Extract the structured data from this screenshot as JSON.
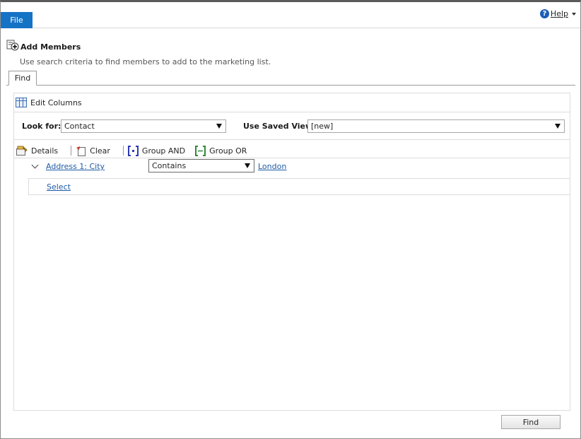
{
  "ribbon": {
    "file_tab": "File",
    "help_label": "Help"
  },
  "header": {
    "title": "Add Members",
    "subtitle": "Use search criteria to find members to add to the marketing list."
  },
  "tabs": [
    {
      "label": "Find"
    }
  ],
  "panel": {
    "edit_columns": "Edit Columns",
    "look_for_label": "Look for:",
    "look_for_value": "Contact",
    "saved_view_label": "Use Saved View:",
    "saved_view_value": "[new]"
  },
  "toolbar": {
    "details": "Details",
    "clear": "Clear",
    "group_and": "Group AND",
    "group_or": "Group OR"
  },
  "criteria": {
    "field": "Address 1: City",
    "operator": "Contains",
    "value": "London",
    "select_link": "Select"
  },
  "footer": {
    "find_button": "Find"
  },
  "colors": {
    "accent": "#1573c6",
    "link": "#1f5ba5"
  }
}
